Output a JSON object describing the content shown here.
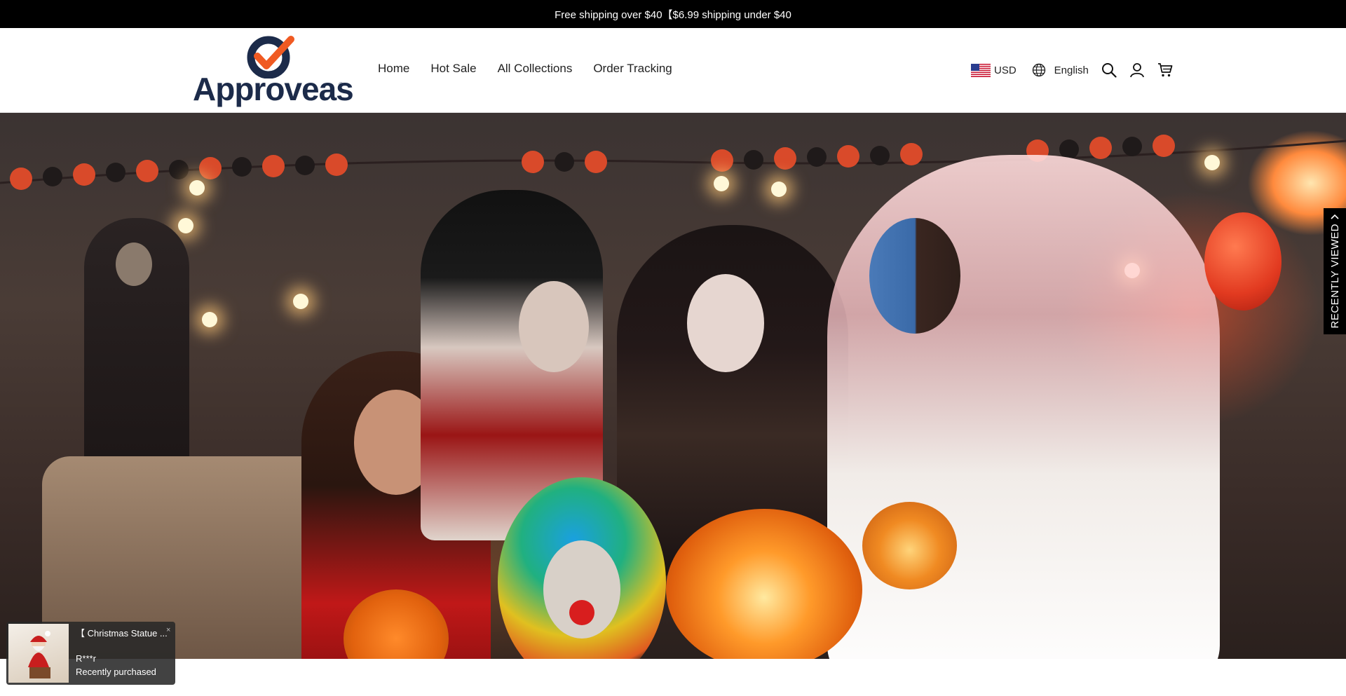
{
  "announcement": {
    "text": "Free shipping over $40【$6.99 shipping under $40"
  },
  "header": {
    "logo_text": "Approveas",
    "logo_mark": "®",
    "nav": [
      {
        "label": "Home"
      },
      {
        "label": "Hot Sale"
      },
      {
        "label": "All Collections"
      },
      {
        "label": "Order Tracking"
      }
    ],
    "currency": {
      "code": "USD",
      "flag": "us-flag-icon"
    },
    "language": {
      "label": "English",
      "icon": "globe-icon"
    },
    "icons": [
      "search-icon",
      "account-icon",
      "cart-icon"
    ]
  },
  "hero": {
    "image": "halloween-costume-party-photo"
  },
  "recently_viewed": {
    "label": "RECENTLY VIEWED",
    "icon": "chevron-up-icon"
  },
  "toast": {
    "product": "【 Christmas Statue ...",
    "user": "R***r",
    "status": "Recently purchased",
    "close": "×"
  },
  "colors": {
    "announcement_bg": "#000000",
    "logo_navy": "#1c2b4a",
    "logo_orange": "#f05a22"
  }
}
